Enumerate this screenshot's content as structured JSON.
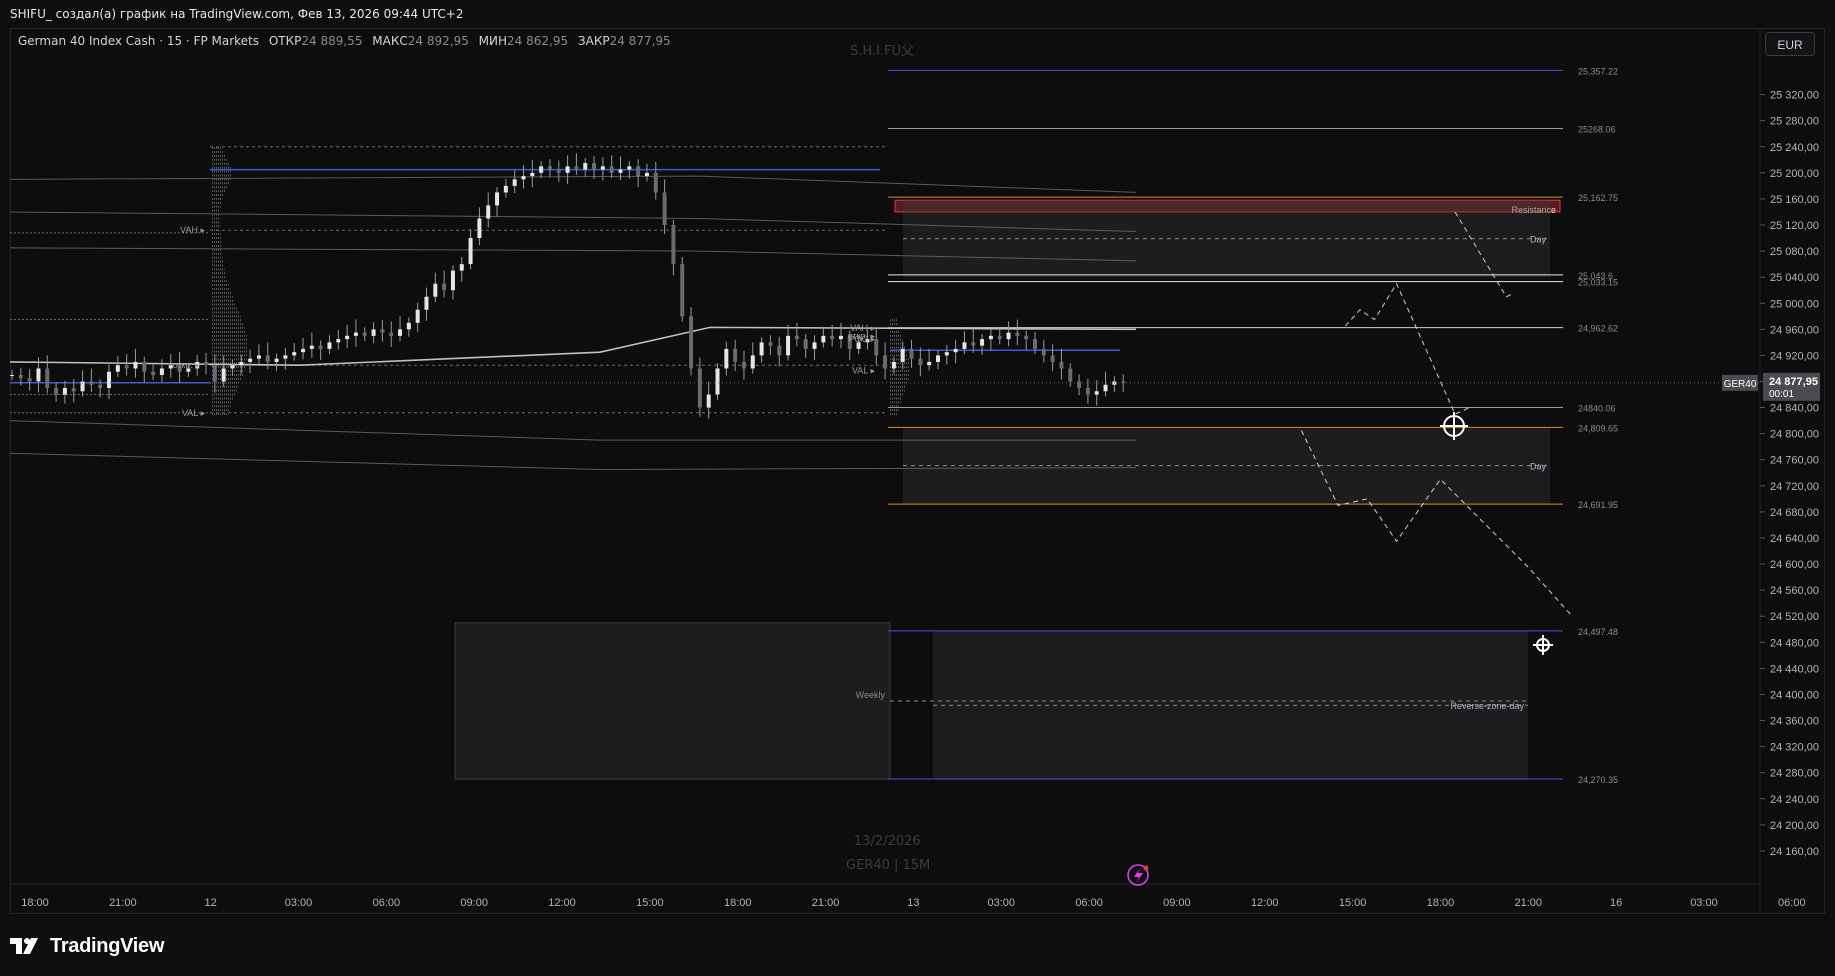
{
  "window": {
    "title": "SHIFU_ создал(а) график на TradingView.com, Фев 13, 2026 09:44 UTC+2"
  },
  "legend": {
    "symbol": "German 40 Index Cash · 15 · FP Markets",
    "open_label": "ОТКР",
    "open": "24 889,55",
    "high_label": "МАКС",
    "high": "24 892,95",
    "low_label": "МИН",
    "low": "24 862,95",
    "close_label": "ЗАКР",
    "close": "24 877,95"
  },
  "toolbar": {
    "currency": "EUR"
  },
  "watermarks": {
    "author": "S.H.I.FU父",
    "date": "13/2/2026",
    "symbol_tf": "GER40 | 15M"
  },
  "brand": {
    "name": "TradingView"
  },
  "colors": {
    "background": "#0d0d0d",
    "resistance": "#e03a3a",
    "orange_level": "#d98a2a",
    "blue_level": "#2f5fd8",
    "purple_level": "#6a3fd6",
    "accent_flash": "#e040fb"
  },
  "chart_data": {
    "type": "candlestick",
    "symbol": "GER40",
    "timeframe": "15",
    "y_axis": {
      "ylim": [
        24140,
        25370
      ],
      "ticks": [
        25320,
        25280,
        25240,
        25200,
        25160,
        25120,
        25080,
        25040,
        25000,
        24960,
        24920,
        24880,
        24840,
        24800,
        24760,
        24720,
        24680,
        24640,
        24600,
        24560,
        24520,
        24480,
        24440,
        24400,
        24360,
        24320,
        24280,
        24240,
        24200,
        24160
      ],
      "tick_labels": [
        "25 320,00",
        "25 280,00",
        "25 240,00",
        "25 200,00",
        "25 160,00",
        "25 120,00",
        "25 080,00",
        "25 040,00",
        "25 000,00",
        "24 960,00",
        "24 920,00",
        "24 880,00",
        "24 840,00",
        "24 800,00",
        "24 760,00",
        "24 720,00",
        "24 680,00",
        "24 640,00",
        "24 600,00",
        "24 560,00",
        "24 520,00",
        "24 480,00",
        "24 440,00",
        "24 400,00",
        "24 360,00",
        "24 320,00",
        "24 280,00",
        "24 240,00",
        "24 200,00",
        "24 160,00"
      ]
    },
    "x_axis": {
      "ticks": [
        {
          "label": "18:00",
          "slot": 0
        },
        {
          "label": "21:00",
          "slot": 12
        },
        {
          "label": "12",
          "slot": 24
        },
        {
          "label": "03:00",
          "slot": 36
        },
        {
          "label": "06:00",
          "slot": 48
        },
        {
          "label": "09:00",
          "slot": 60
        },
        {
          "label": "12:00",
          "slot": 72
        },
        {
          "label": "15:00",
          "slot": 84
        },
        {
          "label": "18:00",
          "slot": 96
        },
        {
          "label": "21:00",
          "slot": 108
        },
        {
          "label": "13",
          "slot": 120
        },
        {
          "label": "03:00",
          "slot": 132
        },
        {
          "label": "06:00",
          "slot": 144
        },
        {
          "label": "09:00",
          "slot": 156
        },
        {
          "label": "12:00",
          "slot": 168
        },
        {
          "label": "15:00",
          "slot": 180
        },
        {
          "label": "18:00",
          "slot": 192
        },
        {
          "label": "21:00",
          "slot": 204
        },
        {
          "label": "16",
          "slot": 216
        },
        {
          "label": "03:00",
          "slot": 228
        },
        {
          "label": "06:00",
          "slot": 240
        }
      ]
    },
    "last_price": {
      "symbol_tag": "GER40",
      "value": 24877.95,
      "label": "24 877,95",
      "countdown": "00:01"
    },
    "candles_close": [
      24890,
      24885,
      24880,
      24900,
      24870,
      24860,
      24870,
      24865,
      24880,
      24875,
      24870,
      24895,
      24905,
      24900,
      24910,
      24895,
      24890,
      24900,
      24905,
      24895,
      24900,
      24910,
      24905,
      24880,
      24900,
      24905,
      24910,
      24915,
      24920,
      24910,
      24915,
      24920,
      24925,
      24930,
      24935,
      24930,
      24940,
      24945,
      24950,
      24955,
      24950,
      24960,
      24955,
      24950,
      24960,
      24970,
      24990,
      25010,
      25030,
      25020,
      25050,
      25060,
      25100,
      25130,
      25150,
      25170,
      25180,
      25190,
      25195,
      25200,
      25210,
      25205,
      25200,
      25210,
      25205,
      25215,
      25205,
      25210,
      25200,
      25205,
      25210,
      25195,
      25200,
      25170,
      25120,
      25060,
      24980,
      24900,
      24840,
      24860,
      24900,
      24930,
      24910,
      24900,
      24920,
      24940,
      24935,
      24920,
      24950,
      24945,
      24930,
      24940,
      24950,
      24945,
      24950,
      24930,
      24940,
      24945,
      24920,
      24900,
      24910,
      24930,
      24915,
      24905,
      24910,
      24920,
      24925,
      24930,
      24940,
      24935,
      24945,
      24950,
      24945,
      24955,
      24950,
      24945,
      24930,
      24920,
      24910,
      24900,
      24880,
      24870,
      24860,
      24865,
      24875,
      24880,
      24878
    ],
    "levels": [
      {
        "value": 25357.22,
        "label": "25,357.22",
        "color": "#6a3fd6",
        "style": "solid"
      },
      {
        "value": 25268.06,
        "label": "25268.06",
        "color": "#9a9aa0",
        "style": "solid"
      },
      {
        "value": 25162.75,
        "label": "25,162.75",
        "color": "#d98a2a",
        "style": "solid"
      },
      {
        "value": 25043.6,
        "label": "25,043.6",
        "color": "#e8e8e8",
        "style": "solid"
      },
      {
        "value": 25033.15,
        "label": "25,033.15",
        "color": "#e8e8e8",
        "style": "solid"
      },
      {
        "value": 24962.62,
        "label": "24,962.62",
        "color": "#cfcfcf",
        "style": "solid"
      },
      {
        "value": 24840.06,
        "label": "24840.06",
        "color": "#9a9aa0",
        "style": "solid"
      },
      {
        "value": 24809.65,
        "label": "24,809.65",
        "color": "#d98a2a",
        "style": "solid"
      },
      {
        "value": 24691.95,
        "label": "24,691.95",
        "color": "#d98a2a",
        "style": "solid"
      },
      {
        "value": 24497.48,
        "label": "24,497.48",
        "color": "#6a3fd6",
        "style": "solid"
      },
      {
        "value": 24270.35,
        "label": "24,270.35",
        "color": "#6a3fd6",
        "style": "solid"
      }
    ],
    "zones": [
      {
        "label": "Resistance",
        "from": 25140,
        "to": 25158,
        "color": "#e03a3a"
      },
      {
        "label": "Day",
        "from": 25040,
        "to": 25158,
        "color": "#2a2a2e"
      },
      {
        "label": "Day",
        "from": 24692,
        "to": 24810,
        "color": "#2a2a2e"
      },
      {
        "label": "Reverse-zone-day",
        "from": 24270,
        "to": 24497,
        "color": "#2a2a2e"
      },
      {
        "label": "Weekly",
        "from": 24270,
        "to": 24510,
        "color": "#2a2a2e"
      }
    ],
    "profile_labels": [
      {
        "text": "VAH",
        "value": 25112
      },
      {
        "text": "откр.",
        "value": 24905
      },
      {
        "text": "VAL",
        "value": 24832
      },
      {
        "text": "VAH",
        "value": 24962
      },
      {
        "text": "POC",
        "value": 24945
      },
      {
        "text": "откр.",
        "value": 24950
      },
      {
        "text": "VAL",
        "value": 24897
      }
    ],
    "projection_path": [
      {
        "slot": 173,
        "value": 24805
      },
      {
        "slot": 178,
        "value": 24690
      },
      {
        "slot": 182,
        "value": 24700
      },
      {
        "slot": 186,
        "value": 24635
      },
      {
        "slot": 192,
        "value": 24730
      },
      {
        "slot": 204,
        "value": 24595
      },
      {
        "slot": 210,
        "value": 24520
      }
    ],
    "projection_path_2": [
      {
        "slot": 179,
        "value": 24965
      },
      {
        "slot": 181,
        "value": 24990
      },
      {
        "slot": 183,
        "value": 24975
      },
      {
        "slot": 186,
        "value": 25030
      },
      {
        "slot": 194,
        "value": 24830
      },
      {
        "slot": 196,
        "value": 24840
      }
    ],
    "projection_path_3": [
      {
        "slot": 194,
        "value": 25140
      },
      {
        "slot": 201,
        "value": 25010
      },
      {
        "slot": 202,
        "value": 25015
      }
    ]
  }
}
